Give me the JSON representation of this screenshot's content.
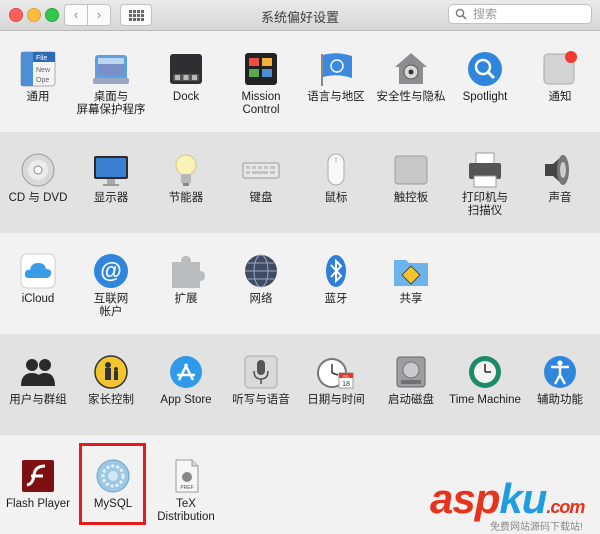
{
  "window": {
    "title": "系统偏好设置"
  },
  "toolbar": {
    "back": "‹",
    "forward": "›"
  },
  "search": {
    "placeholder": "搜索"
  },
  "rows": [
    [
      {
        "name": "general",
        "label": "通用"
      },
      {
        "name": "desktop-screensaver",
        "label": "桌面与\n屏幕保护程序"
      },
      {
        "name": "dock",
        "label": "Dock"
      },
      {
        "name": "mission-control",
        "label": "Mission\nControl"
      },
      {
        "name": "language-region",
        "label": "语言与地区"
      },
      {
        "name": "security-privacy",
        "label": "安全性与隐私"
      },
      {
        "name": "spotlight",
        "label": "Spotlight"
      },
      {
        "name": "notifications",
        "label": "通知"
      }
    ],
    [
      {
        "name": "cd-dvd",
        "label": "CD 与 DVD"
      },
      {
        "name": "displays",
        "label": "显示器"
      },
      {
        "name": "energy-saver",
        "label": "节能器"
      },
      {
        "name": "keyboard",
        "label": "键盘"
      },
      {
        "name": "mouse",
        "label": "鼠标"
      },
      {
        "name": "trackpad",
        "label": "触控板"
      },
      {
        "name": "printers-scanners",
        "label": "打印机与\n扫描仪"
      },
      {
        "name": "sound",
        "label": "声音"
      }
    ],
    [
      {
        "name": "icloud",
        "label": "iCloud"
      },
      {
        "name": "internet-accounts",
        "label": "互联网\n帐户"
      },
      {
        "name": "extensions",
        "label": "扩展"
      },
      {
        "name": "network",
        "label": "网络"
      },
      {
        "name": "bluetooth",
        "label": "蓝牙"
      },
      {
        "name": "sharing",
        "label": "共享"
      }
    ],
    [
      {
        "name": "users-groups",
        "label": "用户与群组"
      },
      {
        "name": "parental-controls",
        "label": "家长控制"
      },
      {
        "name": "app-store",
        "label": "App Store"
      },
      {
        "name": "dictation-speech",
        "label": "听写与语音"
      },
      {
        "name": "date-time",
        "label": "日期与时间"
      },
      {
        "name": "startup-disk",
        "label": "启动磁盘"
      },
      {
        "name": "time-machine",
        "label": "Time Machine"
      },
      {
        "name": "accessibility",
        "label": "辅助功能"
      }
    ],
    [
      {
        "name": "flash-player",
        "label": "Flash Player"
      },
      {
        "name": "mysql",
        "label": "MySQL"
      },
      {
        "name": "tex-distribution",
        "label": "TeX\nDistribution"
      }
    ]
  ],
  "icon_text": {
    "general_file": "File",
    "general_new": "New",
    "general_open": "Ope",
    "date_month": "JUL",
    "date_day": "18",
    "tex_pref": "PREF"
  },
  "watermark": {
    "main_a": "asp",
    "main_k": "ku",
    "main_end": ".com",
    "sub": "免费网站源码下载站!"
  },
  "colors": {
    "highlight": "#e31b1b",
    "accent_blue": "#1f9de0",
    "watermark_red": "#e8331c"
  }
}
